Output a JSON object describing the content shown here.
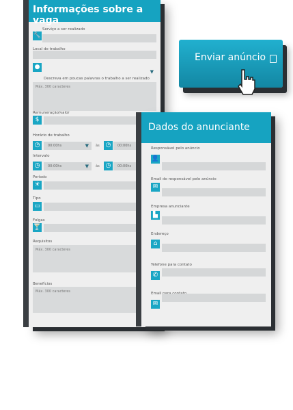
{
  "left": {
    "title": "Informações sobre a vaga",
    "fields": {
      "service": "Serviço a ser realizado",
      "location": "Local de trabalho",
      "description": "Descreva em poucas palavras o trabalho a ser realizado",
      "description_placeholder": "Máx. 300 caracteres",
      "pay": "Remuneração/valor",
      "hours": "Horário de trabalho",
      "interval": "Intervalo",
      "period": "Período",
      "type": "Tipo",
      "leave": "Folgas",
      "requirements": "Requisitos",
      "requirements_placeholder": "Máx. 300 caracteres",
      "benefits": "Benefícios",
      "benefits_placeholder": "Máx. 300 caracteres"
    },
    "time_from": "00:00hs",
    "time_sep": "às",
    "time_to": "00:00hs"
  },
  "right": {
    "title": "Dados do anunciante",
    "fields": {
      "responsible": "Responsável pelo anúncio",
      "email_responsible": "Email do responsável pelo anúncio",
      "company": "Empresa anunciante",
      "address": "Endereço",
      "phone": "Telefone para contato",
      "email_contact": "Email para contato"
    }
  },
  "button": {
    "label": "Enviar anúncio"
  },
  "colors": {
    "accent": "#16a3c1",
    "panel": "#efefef",
    "field": "#d5d7d8",
    "shadow": "#2b2f33"
  }
}
